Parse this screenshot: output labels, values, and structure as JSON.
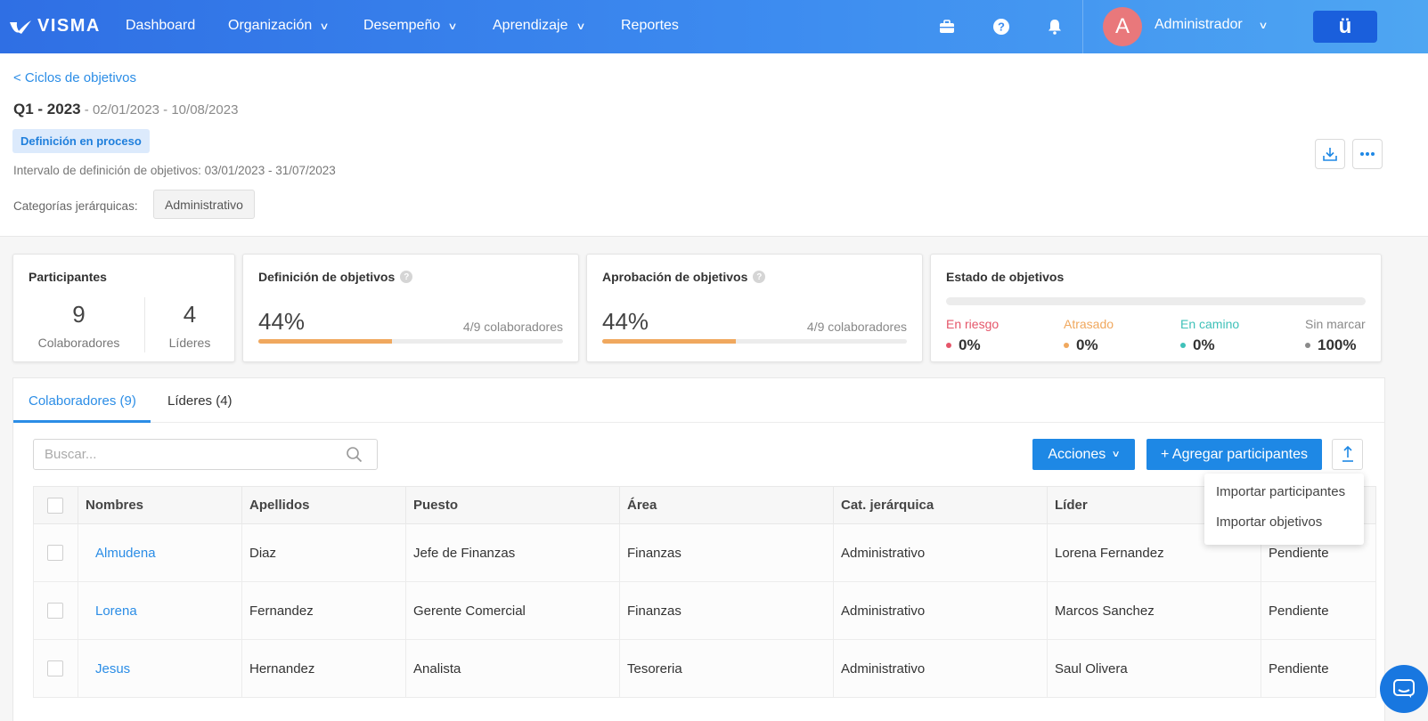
{
  "nav": {
    "logo_text": "VISMA",
    "items": [
      {
        "label": "Dashboard"
      },
      {
        "label": "Organización"
      },
      {
        "label": "Desempeño"
      },
      {
        "label": "Aprendizaje"
      },
      {
        "label": "Reportes"
      }
    ],
    "user_initial": "A",
    "user_name": "Administrador",
    "brand_glyph": "ü",
    "icons": [
      "briefcase-icon",
      "help-icon",
      "bell-icon"
    ]
  },
  "header": {
    "back_link": "< Ciclos de objetivos",
    "cycle_name": "Q1 - 2023",
    "cycle_dates": " - 02/01/2023 - 10/08/2023",
    "status": "Definición en proceso",
    "interval": "Intervalo de definición de objetivos: 03/01/2023 - 31/07/2023",
    "category_label": "Categorías jerárquicas:",
    "category_value": "Administrativo"
  },
  "cards": {
    "participantes": {
      "title": "Participantes",
      "colaboradores_count": "9",
      "colaboradores_label": "Colaboradores",
      "lideres_count": "4",
      "lideres_label": "Líderes"
    },
    "definicion": {
      "title": "Definición de objetivos",
      "percent": "44%",
      "progress": 0.44,
      "sub": "4/9 colaboradores"
    },
    "aprobacion": {
      "title": "Aprobación de objetivos",
      "percent": "44%",
      "progress": 0.44,
      "sub": "4/9 colaboradores"
    },
    "estado": {
      "title": "Estado de objetivos",
      "items": [
        {
          "label": "En riesgo",
          "value": "0%",
          "color": "#e5566a"
        },
        {
          "label": "Atrasado",
          "value": "0%",
          "color": "#f0a85e"
        },
        {
          "label": "En camino",
          "value": "0%",
          "color": "#3fc1b9"
        },
        {
          "label": "Sin marcar",
          "value": "100%",
          "color": "#8a8a8a"
        }
      ]
    }
  },
  "tabs": [
    {
      "label": "Colaboradores (9)"
    },
    {
      "label": "Líderes (4)"
    }
  ],
  "toolbar": {
    "search_placeholder": "Buscar...",
    "actions_label": "Acciones",
    "add_label": "+ Agregar participantes"
  },
  "dropdown": {
    "items": [
      "Importar participantes",
      "Importar objetivos"
    ]
  },
  "table": {
    "columns": [
      "Nombres",
      "Apellidos",
      "Puesto",
      "Área",
      "Cat. jerárquica",
      "Líder",
      ""
    ],
    "rows": [
      {
        "nombre": "Almudena",
        "apellido": "Diaz",
        "puesto": "Jefe de Finanzas",
        "area": "Finanzas",
        "cat": "Administrativo",
        "lider": "Lorena Fernandez",
        "estado": "Pendiente"
      },
      {
        "nombre": "Lorena",
        "apellido": "Fernandez",
        "puesto": "Gerente Comercial",
        "area": "Finanzas",
        "cat": "Administrativo",
        "lider": "Marcos Sanchez",
        "estado": "Pendiente"
      },
      {
        "nombre": "Jesus",
        "apellido": "Hernandez",
        "puesto": "Analista",
        "area": "Tesoreria",
        "cat": "Administrativo",
        "lider": "Saul Olivera",
        "estado": "Pendiente"
      }
    ]
  },
  "colors": {
    "primary": "#1e88e5",
    "link": "#2b8de6",
    "progress": "#f0a85e"
  }
}
